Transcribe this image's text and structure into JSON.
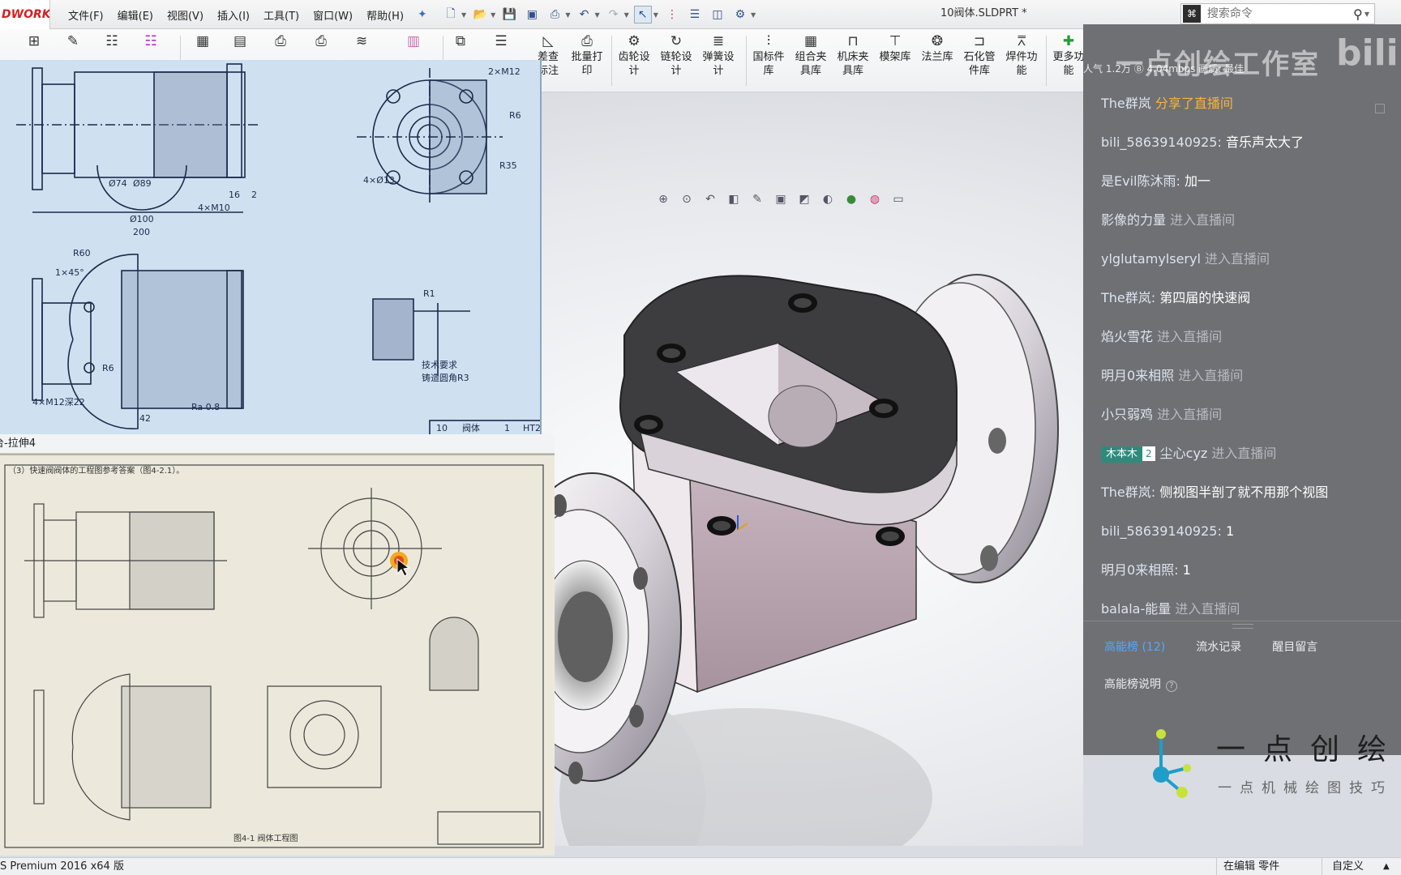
{
  "app": {
    "logo_text": "DWORKS",
    "document_title": "10阀体.SLDPRT *",
    "status_version": "S Premium 2016 x64 版",
    "status_mode": "在编辑 零件",
    "status_units": "自定义"
  },
  "menu": [
    "文件(F)",
    "编辑(E)",
    "视图(V)",
    "插入(I)",
    "工具(T)",
    "窗口(W)",
    "帮助(H)"
  ],
  "search": {
    "placeholder": "搜索命令"
  },
  "toolbar": {
    "buttons": [
      {
        "label": "差查\n标注",
        "icon": "dimension-check-icon"
      },
      {
        "label": "批量打\n印",
        "icon": "print-icon"
      },
      {
        "label": "齿轮设\n计",
        "icon": "gear-icon"
      },
      {
        "label": "链轮设\n计",
        "icon": "sprocket-icon"
      },
      {
        "label": "弹簧设\n计",
        "icon": "spring-icon"
      },
      {
        "label": "国标件\n库",
        "icon": "bolt-icon"
      },
      {
        "label": "组合夹\n具库",
        "icon": "fixture-icon"
      },
      {
        "label": "机床夹\n具库",
        "icon": "clamp-icon"
      },
      {
        "label": "模架库",
        "icon": "mold-icon"
      },
      {
        "label": "法兰库",
        "icon": "flange-icon"
      },
      {
        "label": "石化管\n件库",
        "icon": "pipe-icon"
      },
      {
        "label": "焊件功\n能",
        "icon": "weld-icon"
      },
      {
        "label": "更多功\n能",
        "icon": "plus-icon"
      }
    ]
  },
  "feature_tree": {
    "current": "台-拉伸4"
  },
  "drawing_top": {
    "labels": [
      "2×M12",
      "R6",
      "R35",
      "4×Ø13",
      "Ø74",
      "Ø89",
      "4×M10",
      "Ø100",
      "200",
      "16",
      "2",
      "1×45°",
      "R60",
      "R1",
      "R6",
      "4×M12深22",
      "42",
      "Ra 0.8",
      "技术要求",
      "铸造圆角R3",
      "10",
      "阀体",
      "1",
      "HT2"
    ]
  },
  "drawing_bottom": {
    "heading": "（3）快速阀阀体的工程图参考答案（图4-2.1）。",
    "caption": "图4-1  阀体工程图"
  },
  "chat": {
    "watermark": "一点创绘工作室",
    "stats": "人气 1.2万    Ⓑ 4.04mbps    画质: 最佳",
    "messages": [
      {
        "user": "The群岚",
        "text": "分享了直播间",
        "kind": "share"
      },
      {
        "user": "bili_58639140925:",
        "text": "音乐声太大了",
        "kind": "text"
      },
      {
        "user": "是Evil陈沐雨:",
        "text": "加一",
        "kind": "text"
      },
      {
        "user": "影像的力量",
        "text": "进入直播间",
        "kind": "enter"
      },
      {
        "user": "ylglutamylseryl",
        "text": "进入直播间",
        "kind": "enter"
      },
      {
        "user": "The群岚:",
        "text": "第四届的快速阀",
        "kind": "text"
      },
      {
        "user": "焰火雪花",
        "text": "进入直播间",
        "kind": "enter"
      },
      {
        "user": "明月0来相照",
        "text": "进入直播间",
        "kind": "enter"
      },
      {
        "user": "小只弱鸡",
        "text": "进入直播间",
        "kind": "enter"
      },
      {
        "user": "尘心cyz",
        "text": "进入直播间",
        "kind": "enter",
        "medal": "木本木",
        "medal_level": "2"
      },
      {
        "user": "The群岚:",
        "text": "侧视图半剖了就不用那个视图",
        "kind": "text"
      },
      {
        "user": "bili_58639140925:",
        "text": "1",
        "kind": "text"
      },
      {
        "user": "明月0来相照:",
        "text": "1",
        "kind": "text"
      },
      {
        "user": "balala-能量",
        "text": "进入直播间",
        "kind": "enter"
      }
    ],
    "tabs": [
      "高能榜 (12)",
      "流水记录",
      "醒目留言"
    ],
    "note": "高能榜说明"
  },
  "brand": {
    "title": "一点创绘",
    "subtitle": "一点机械绘图技巧"
  },
  "colors": {
    "chat_bg": "#6f7074",
    "accent_blue": "#53a7ff",
    "share_orange": "#f5b342",
    "medal_green": "#2f8a7c"
  }
}
